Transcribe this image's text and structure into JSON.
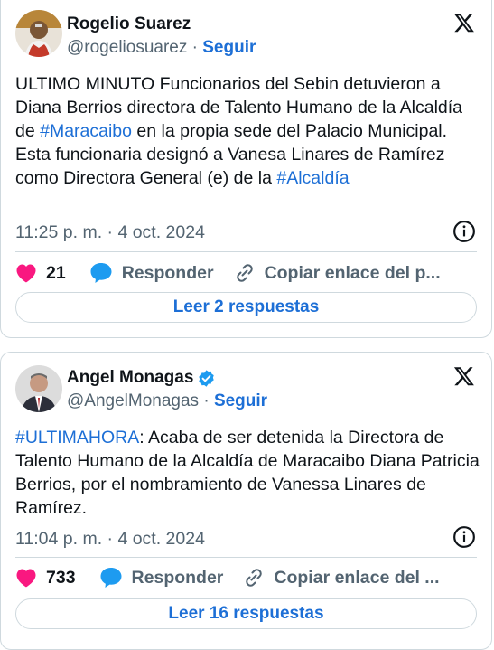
{
  "tweets": [
    {
      "author": "Rogelio Suarez",
      "handle": "@rogeliosuarez",
      "separator": "·",
      "follow_label": "Seguir",
      "text_parts": [
        "ULTIMO MINUTO Funcionarios del Sebin detuvieron a Diana Berrios directora de Talento Humano de la Alcaldía de ",
        "#Maracaibo",
        " en la propia sede del Palacio Municipal. Esta funcionaria designó a Vanesa Linares de Ramírez como Directora General (e) de la ",
        "#Alcaldía"
      ],
      "time": "11:25 p. m. · 4 oct. 2024",
      "likes": "21",
      "reply_label": "Responder",
      "copy_label": "Copiar enlace del p...",
      "read_label": "Leer 2 respuestas"
    },
    {
      "author": "Angel Monagas",
      "verified": true,
      "handle": "@AngelMonagas",
      "separator": "·",
      "follow_label": "Seguir",
      "text_parts": [
        "#ULTIMAHORA",
        ": Acaba de ser detenida la Directora de Talento Humano de la Alcaldía de Maracaibo Diana Patricia Berrios, por el nombramiento de Vanessa Linares de Ramírez."
      ],
      "time": "11:04 p. m. · 4 oct. 2024",
      "likes": "733",
      "reply_label": "Responder",
      "copy_label": "Copiar enlace del ...",
      "read_label": "Leer 16 respuestas"
    }
  ],
  "colors": {
    "accent": "#1d6fd6",
    "like": "#f91880",
    "verified": "#1d9bf0",
    "muted": "#536471"
  },
  "icons": [
    "x-logo-icon",
    "info-icon",
    "heart-icon",
    "reply-bubble-icon",
    "link-icon",
    "verified-badge-icon"
  ]
}
